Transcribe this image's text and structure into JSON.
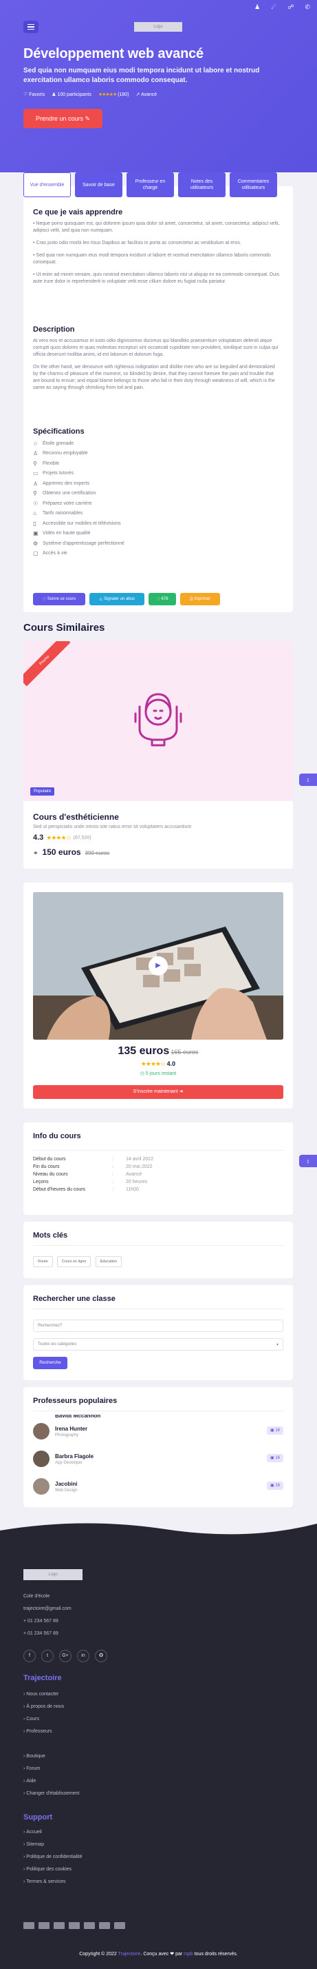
{
  "topbar": {
    "icons": [
      "person-icon",
      "megaphone-icon",
      "cart-icon",
      "phone-icon"
    ]
  },
  "header": {
    "logo_text": "Logo"
  },
  "hero": {
    "title": "Développement web avancé",
    "subtitle": "Sed quia non numquam eius modi tempora incidunt ut labore et nostrud exercitation ullamco laboris commodo consequat.",
    "meta": {
      "favoris": "Favoris",
      "participants": "100 participants",
      "stars": "★★★★★",
      "reviews": "(180)",
      "level": "Avancé"
    },
    "cta_label": "Prendre un cours"
  },
  "tabs": [
    "Vue d'ensemble",
    "Savoir de base",
    "Professeur en charge",
    "Notes des utilisateurs",
    "Commentaires utilisateurs"
  ],
  "learn": {
    "title": "Ce que je vais apprendre",
    "items": [
      "• Neque porro quisquam est, qui dolorem ipsum quia dolor sit amet, consectetur, sit amet, consectetur, adipisci velit, adipisci velit, sed quia non numquam.",
      "• Cras justo odio morbi leo risus Dapibus ac facilisis in porta ac consectetur ac vestibulum at eros.",
      "• Sed quia non numquam eius modi tempora incidunt ut labore et nostrud exercitation ullamco laboris commodo consequat.",
      "• Ut enim ad minim veniam, quis nostrud exercitation ullamco laboris nisi ut aliquip ex ea commodo consequat. Duis aute irure dolor in reprehenderit in voluptate velit esse cillum dolore eu fugiat nulla pariatur."
    ]
  },
  "description": {
    "title": "Description",
    "p1": "At vero eos et accusamus et iusto odio dignissimos ducimus qui blanditiis praesentium voluptatum deleniti atque corrupti quos dolores et quas molestias excepturi sint occaecati cupiditate non provident, similique sunt in culpa qui officia deserunt mollitia animi, id est laborum et dolorum fuga.",
    "p2": "On the other hand, we denounce with righteous indignation and dislike men who are so beguiled and demoralized by the charms of pleasure of the moment, so blinded by desire, that they cannot foresee the pain and trouble that are bound to ensue; and equal blame belongs to those who fail in their duty through weakness of will, which is the same as saying through shrinking from toil and pain."
  },
  "specs": {
    "title": "Spécifications",
    "items": [
      {
        "icon": "star-icon",
        "glyph": "☆",
        "label": "Étoile grenade"
      },
      {
        "icon": "user-icon",
        "glyph": "♙",
        "label": "Reconnu employable"
      },
      {
        "icon": "flexible-icon",
        "glyph": "⚲",
        "label": "Flexible"
      },
      {
        "icon": "folder-icon",
        "glyph": "▭",
        "label": "Projets tutorés"
      },
      {
        "icon": "expert-icon",
        "glyph": "♙",
        "label": "Apprenez des experts"
      },
      {
        "icon": "certificate-icon",
        "glyph": "⚲",
        "label": "Obtenez une certification"
      },
      {
        "icon": "career-icon",
        "glyph": "☉",
        "label": "Préparez votre carrière"
      },
      {
        "icon": "price-tag-icon",
        "glyph": "⌂",
        "label": "Tarifs raisonnables"
      },
      {
        "icon": "mobile-icon",
        "glyph": "▯",
        "label": "Accessible sur mobiles et télévisions"
      },
      {
        "icon": "video-icon",
        "glyph": "▣",
        "label": "Vidéo en haute qualité"
      },
      {
        "icon": "system-icon",
        "glyph": "⚙",
        "label": "Système d'apprentissage perfectionné"
      },
      {
        "icon": "lock-icon",
        "glyph": "▢",
        "label": "Accès à vie"
      }
    ]
  },
  "share": {
    "follow": "Suivre ce cours",
    "report": "Signaler un abus",
    "count": "678",
    "print": "Imprimer"
  },
  "similar": {
    "title": "Cours Similaires",
    "ribbon": "Promo",
    "badge": "Populaire",
    "course_title": "Cours d'esthéticienne",
    "course_sub": "Sed ut perspiciatis unde omnis iste natus error sit voluptatem accusantium",
    "rating": "4.3",
    "stars": "★★★★☆",
    "reviews": "(67,520)",
    "price": "150 euros",
    "old_price": "390 euros"
  },
  "purchase": {
    "price": "135 euros",
    "old_price": "165 euros",
    "stars": "★★★★☆",
    "rating": "4.0",
    "timer": "5 jours restant",
    "button": "S'inscrire maintenant"
  },
  "info": {
    "title": "Info du cours",
    "rows": [
      {
        "k": "Début du cours",
        "v": "14 avril 2022"
      },
      {
        "k": "Fin du cours",
        "v": "20 mai 2022"
      },
      {
        "k": "Niveau du cours",
        "v": "Avancé"
      },
      {
        "k": "Leçons",
        "v": "20 heures"
      },
      {
        "k": "Début d'heures du cours",
        "v": "11h00"
      }
    ]
  },
  "keywords": {
    "title": "Mots clés",
    "tags": [
      "Route",
      "Cours en ligne",
      "Éducation"
    ]
  },
  "search": {
    "title": "Rechercher une classe",
    "placeholder": "Recherchez?",
    "select": "Toutes les catégories",
    "button": "Recherche"
  },
  "professors": {
    "title": "Professeurs populaires",
    "partial_name": "Bavidt Mccannon",
    "items": [
      {
        "name": "Irena Hunter",
        "role": "Photography",
        "count": "16"
      },
      {
        "name": "Barbra Flagole",
        "role": "App Developer",
        "count": "16"
      },
      {
        "name": "Jacobini",
        "role": "Web Design",
        "count": "16"
      }
    ]
  },
  "footer": {
    "logo_text": "Logo",
    "school": "Cole d'école",
    "email": "trajectoire@gmail.com",
    "phone1": "+ 01 234 567 89",
    "phone2": "+ 01 234 567 89",
    "social": [
      "f",
      "t",
      "G+",
      "in",
      "✪"
    ],
    "col1_title": "Trajectoire",
    "col1": [
      "Nous contacter",
      "À propos de nous",
      "Cours",
      "Professeurs",
      "",
      "Boutique",
      "Forum",
      "Aide",
      "Changer d'établissement"
    ],
    "col2_title": "Support",
    "col2": [
      "Accueil",
      "Sitemap",
      "Politique de confidentialité",
      "Politique des cookies",
      "Termes & services"
    ],
    "copyright_prefix": "Copyright © 2022",
    "brand": "Trajectoire",
    "made_by": ". Conçu avec ❤ par",
    "author": "rspb",
    "rights": "tous droits réservés."
  },
  "colors": {
    "primary": "#6158e8",
    "accent": "#ef4b4b",
    "footer": "#262633"
  }
}
